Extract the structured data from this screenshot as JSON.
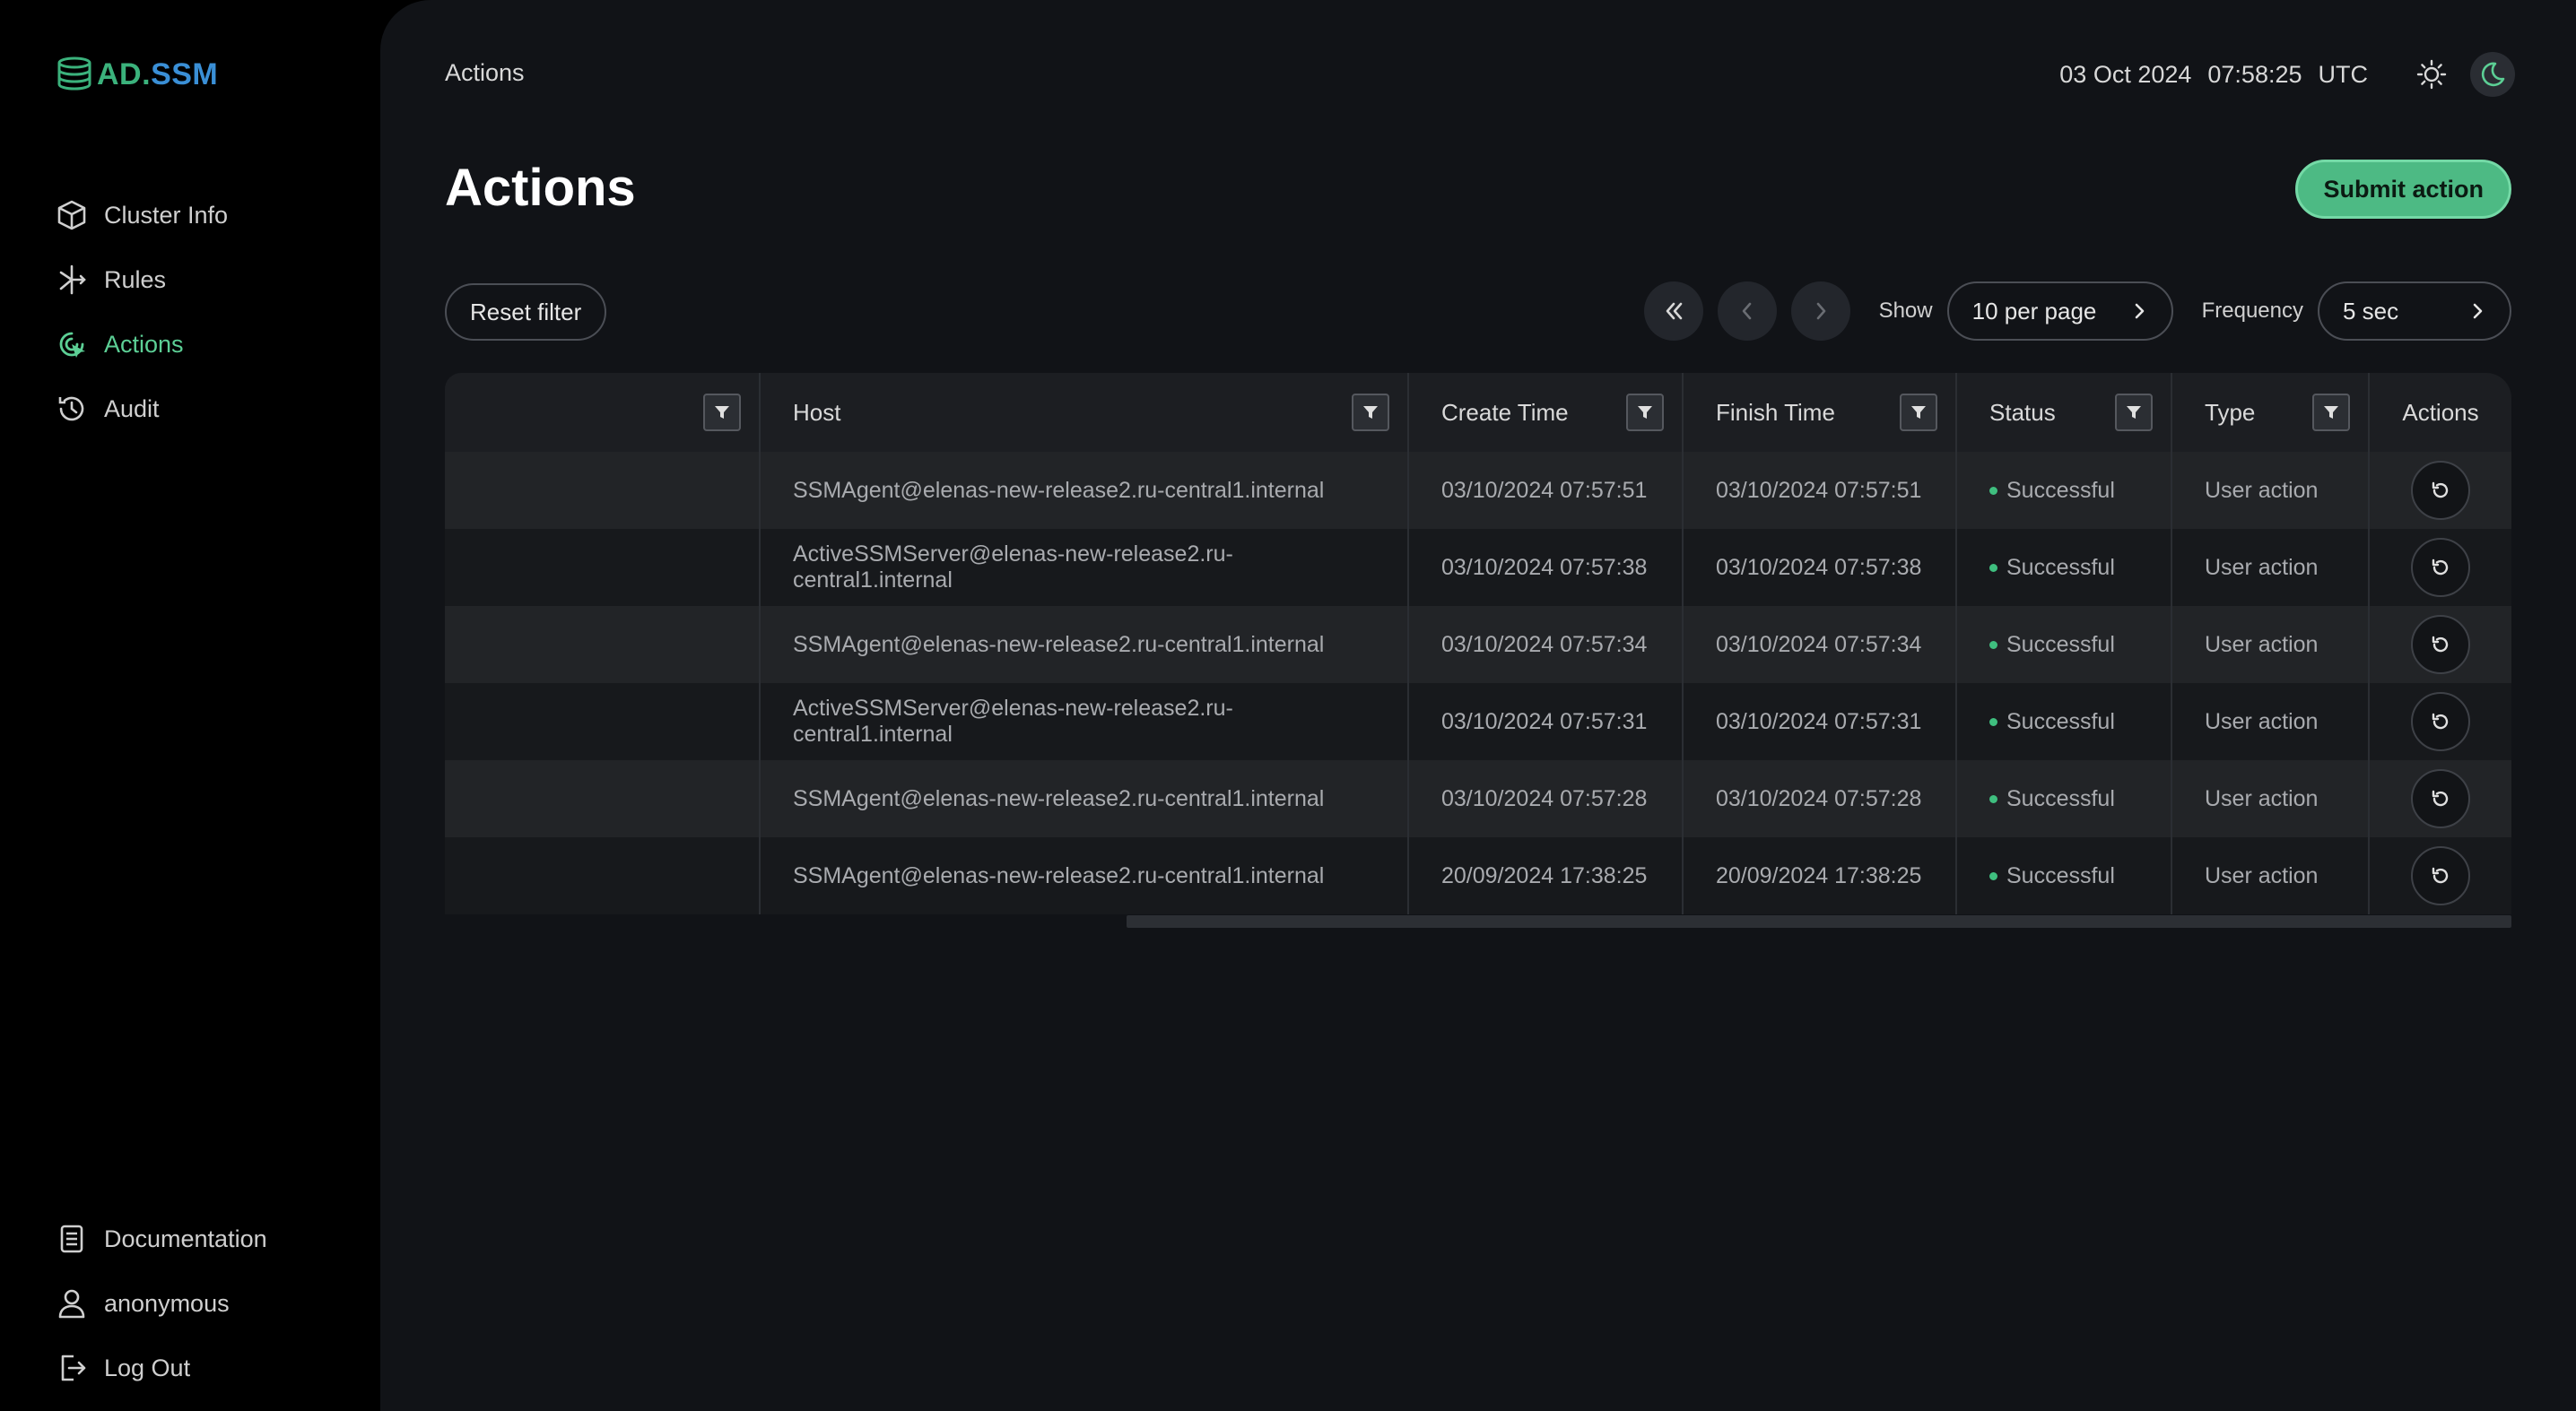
{
  "brand": {
    "logo_text_a": "AD.",
    "logo_text_b": "SSM"
  },
  "sidebar": {
    "items": [
      {
        "label": "Cluster Info",
        "icon": "cube-icon"
      },
      {
        "label": "Rules",
        "icon": "branch-icon"
      },
      {
        "label": "Actions",
        "icon": "actions-icon",
        "active": true
      },
      {
        "label": "Audit",
        "icon": "history-icon"
      }
    ],
    "bottom": [
      {
        "label": "Documentation",
        "icon": "document-icon"
      },
      {
        "label": "anonymous",
        "icon": "user-icon"
      },
      {
        "label": "Log Out",
        "icon": "logout-icon"
      }
    ]
  },
  "header": {
    "breadcrumb": "Actions",
    "date": "03 Oct 2024",
    "time": "07:58:25",
    "timezone": "UTC"
  },
  "page": {
    "title": "Actions",
    "submit_label": "Submit action",
    "reset_label": "Reset filter"
  },
  "pager": {
    "show_label": "Show",
    "per_page": "10 per page",
    "frequency_label": "Frequency",
    "frequency": "5 sec"
  },
  "table": {
    "columns": [
      "",
      "Host",
      "Create Time",
      "Finish Time",
      "Status",
      "Type",
      "Actions"
    ],
    "rows": [
      {
        "host": "SSMAgent@elenas-new-release2.ru-central1.internal",
        "create": "03/10/2024 07:57:51",
        "finish": "03/10/2024 07:57:51",
        "status": "Successful",
        "type": "User action"
      },
      {
        "host": "ActiveSSMServer@elenas-new-release2.ru-central1.internal",
        "create": "03/10/2024 07:57:38",
        "finish": "03/10/2024 07:57:38",
        "status": "Successful",
        "type": "User action"
      },
      {
        "host": "SSMAgent@elenas-new-release2.ru-central1.internal",
        "create": "03/10/2024 07:57:34",
        "finish": "03/10/2024 07:57:34",
        "status": "Successful",
        "type": "User action"
      },
      {
        "host": "ActiveSSMServer@elenas-new-release2.ru-central1.internal",
        "create": "03/10/2024 07:57:31",
        "finish": "03/10/2024 07:57:31",
        "status": "Successful",
        "type": "User action"
      },
      {
        "host": "SSMAgent@elenas-new-release2.ru-central1.internal",
        "create": "03/10/2024 07:57:28",
        "finish": "03/10/2024 07:57:28",
        "status": "Successful",
        "type": "User action"
      },
      {
        "host": "SSMAgent@elenas-new-release2.ru-central1.internal",
        "create": "20/09/2024 17:38:25",
        "finish": "20/09/2024 17:38:25",
        "status": "Successful",
        "type": "User action"
      }
    ]
  },
  "colors": {
    "accent": "#5ccf95",
    "button": "#4dba84",
    "status_ok": "#3fbf7f"
  }
}
